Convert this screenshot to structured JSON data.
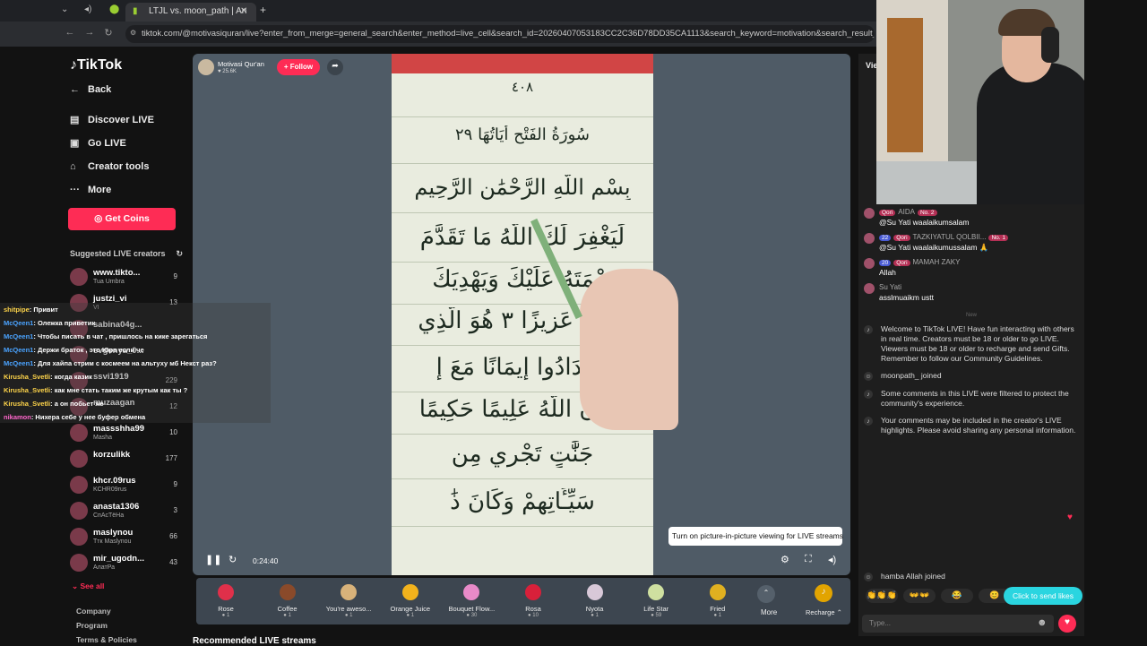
{
  "browser": {
    "tab_title": "LTJL vs. moon_path | An",
    "url": "tiktok.com/@motivasiquran/live?enter_from_merge=general_search&enter_method=live_cell&search_id=20260407053183CC2C36D78DD35CA1113&search_keyword=motivation&search_result_id=14&search_type=g"
  },
  "sidebar": {
    "logo": "TikTok",
    "back": "Back",
    "nav": [
      {
        "icon": "discover-live-icon",
        "label": "Discover LIVE"
      },
      {
        "icon": "go-live-icon",
        "label": "Go LIVE"
      },
      {
        "icon": "creator-tools-icon",
        "label": "Creator tools"
      },
      {
        "icon": "more-icon",
        "label": "More"
      }
    ],
    "get_coins": "Get Coins",
    "suggested_title": "Suggested LIVE creators",
    "creators": [
      {
        "name": "www.tikto...",
        "sub": "Tua Umbra",
        "count": "9"
      },
      {
        "name": "justzi_vi",
        "sub": "VI",
        "count": "13"
      },
      {
        "name": "sabina04g...",
        "sub": "",
        "count": ""
      },
      {
        "name": "evgenya_0...",
        "sub": "",
        "count": ""
      },
      {
        "name": "ssvi1919",
        "sub": "",
        "count": "229"
      },
      {
        "name": "muzaagan",
        "sub": "",
        "count": "12"
      },
      {
        "name": "massshha99",
        "sub": "Masha",
        "count": "10"
      },
      {
        "name": "korzulikk",
        "sub": "",
        "count": "177"
      },
      {
        "name": "khcr.09rus",
        "sub": "KCHR09rus",
        "count": "9"
      },
      {
        "name": "anasta1306",
        "sub": "СпАсТёНа",
        "count": "3"
      },
      {
        "name": "maslynou",
        "sub": "Ттк Maslynou",
        "count": "66"
      },
      {
        "name": "mir_ugodn...",
        "sub": "АлатРа",
        "count": "43"
      }
    ],
    "see_all": "See all",
    "footer": [
      "Company",
      "Program",
      "Terms & Policies"
    ]
  },
  "overlay_chat": [
    {
      "user": "shitpipe",
      "user_color": "#ffd54a",
      "text": ": Привит"
    },
    {
      "user": "McQeen1",
      "user_color": "#4aa3ff",
      "text": ": Олежка приветик"
    },
    {
      "user": "McQeen1",
      "user_color": "#4aa3ff",
      "text": ": Чтобы писать в чат , пришлось на кике зарегаться"
    },
    {
      "user": "McQeen1",
      "user_color": "#4aa3ff",
      "text": ": Держи браток , это Юра если че"
    },
    {
      "user": "McQeen1",
      "user_color": "#4aa3ff",
      "text": ": Для хайпа стрим с космеем на альтуху мб Некст раз?"
    },
    {
      "user": "Kirusha_Svetli",
      "user_color": "#ffd54a",
      "text": ": когда казик"
    },
    {
      "user": "Kirusha_Svetli",
      "user_color": "#ffd54a",
      "text": ": как мне стать таким же крутым как ты ?"
    },
    {
      "user": "Kirusha_Svetli",
      "user_color": "#ffd54a",
      "text": ": а он побьет же"
    },
    {
      "user": "nikamon",
      "user_color": "#ff66cc",
      "text": ": Нихера себе у нее буфер обмена"
    }
  ],
  "player": {
    "host_name": "Motivasi Qur'an",
    "host_viewers": "25.6K",
    "follow": "+ Follow",
    "video_lines": [
      "٤٠٨",
      "سُورَةُ الفَتْحِ  أَيَاتُهَا ٢٩",
      "بِسْمِ اللَّهِ الرَّحْمَٰنِ الرَّحِيمِ",
      "لِّيَغْفِرَ لَكَ اللَّهُ مَا تَقَدَّمَ",
      "نِعْمَتَهُ عَلَيْكَ وَيَهْدِيَكَ",
      "نَصْرًا عَزِيزًا ٣ هُوَ الَّذِي",
      "لِيَزْدَادُوا إِيمَانًا مَعَ إِ",
      "وَكَانَ اللَّهُ عَلِيمًا حَكِيمًا",
      "جَنَّٰتٍ تَجْرِي مِن",
      "سَيِّـَٔاتِهِمْ وَكَانَ ذَٰ"
    ],
    "time": "0:24:40",
    "pip_text": "Turn on picture-in-picture viewing for LIVE streams",
    "pip_button": "Turn on"
  },
  "gifts": [
    {
      "name": "Rose",
      "price": "1",
      "color": "#e0304a"
    },
    {
      "name": "Coffee",
      "price": "1",
      "color": "#8a4a2a"
    },
    {
      "name": "You're aweso...",
      "price": "1",
      "color": "#d8b27a"
    },
    {
      "name": "Orange Juice",
      "price": "1",
      "color": "#f2b21c"
    },
    {
      "name": "Bouquet Flow...",
      "price": "30",
      "color": "#e88ac8"
    },
    {
      "name": "Rosa",
      "price": "10",
      "color": "#d8203a"
    },
    {
      "name": "Nyota",
      "price": "1",
      "color": "#d8c8d8"
    },
    {
      "name": "Life Star",
      "price": "59",
      "color": "#cfe0a0"
    },
    {
      "name": "Fried",
      "price": "1",
      "color": "#e0b020"
    }
  ],
  "gifts_more": "More",
  "recharge": "Recharge",
  "recommended": "Recommended LIVE streams",
  "chat": {
    "header": "Vie",
    "messages": [
      {
        "badges": [
          "Qori"
        ],
        "name": "AIDA",
        "rank": "No. 2",
        "text": "@Su Yati waalaikumsalam"
      },
      {
        "badges": [
          "22",
          "Qori"
        ],
        "name": "TAZKIYATUL QOLBII...",
        "rank": "No. 1",
        "text": "@Su Yati waalaikumussalam 🙏"
      },
      {
        "badges": [
          "20",
          "Qori"
        ],
        "name": "MAMAH ZAKY",
        "rank": "",
        "text": "Allah"
      },
      {
        "badges": [],
        "name": "Su Yati",
        "rank": "",
        "text": "asslmuaikm ustt"
      }
    ],
    "new_label": "New",
    "system": [
      "Welcome to TikTok LIVE! Have fun interacting with others in real time. Creators must be 18 or older to go LIVE. Viewers must be 18 or older to recharge and send Gifts. Remember to follow our Community Guidelines.",
      "moonpath_  joined",
      "Some comments in this LIVE were filtered to protect the community's experience.",
      "Your comments may be included in the creator's LIVE highlights. Please avoid sharing any personal information."
    ],
    "joined": "hamba Allah  joined",
    "emojis": [
      "👏👏👏",
      "👐👐",
      "😂",
      "😊"
    ],
    "input_placeholder": "Type...",
    "likes_button": "Click to send likes"
  }
}
